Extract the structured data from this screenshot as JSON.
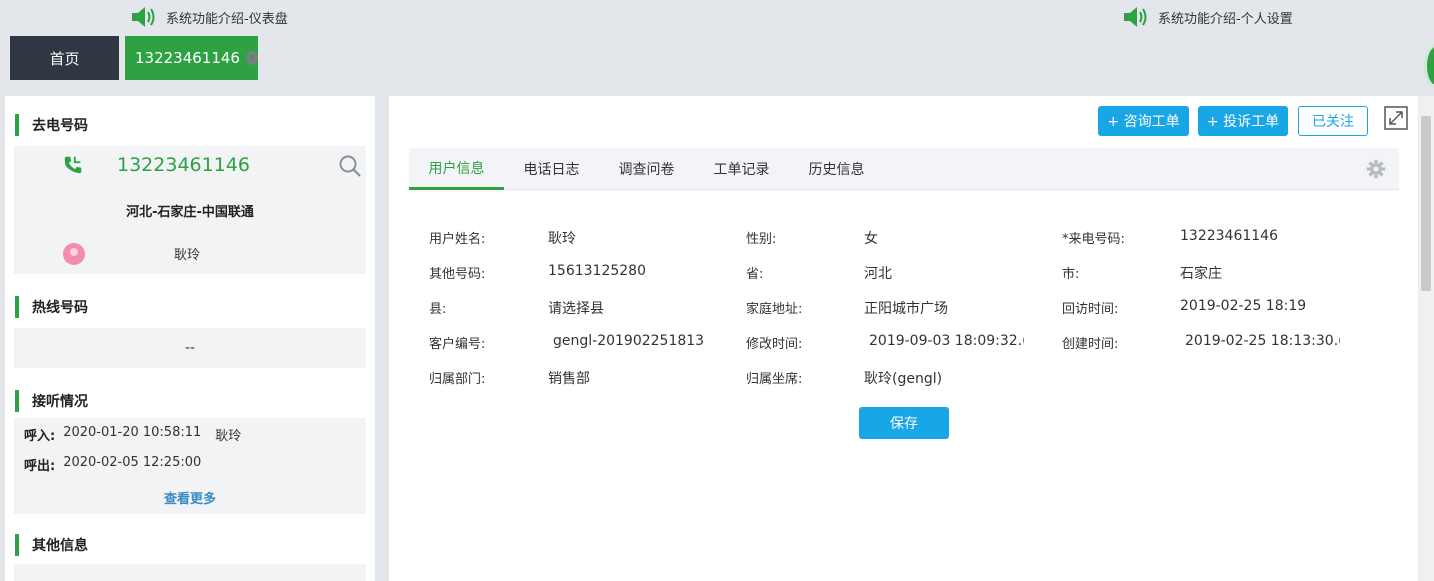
{
  "announcements": [
    "系统功能介绍-仪表盘",
    "系统功能介绍-个人设置"
  ],
  "tabs": {
    "home": "首页",
    "phone": "13223461146",
    "close_glyph": "×"
  },
  "left": {
    "outgoing": {
      "title": "去电号码",
      "number": "13223461146",
      "region": "河北-石家庄-中国联通",
      "user": "耿玲"
    },
    "hotline": {
      "title": "热线号码",
      "value": "--"
    },
    "calls": {
      "title": "接听情况",
      "in_label": "呼入:",
      "in_time": "2020-01-20 10:58:11",
      "in_user": "耿玲",
      "out_label": "呼出:",
      "out_time": "2020-02-05 12:25:00",
      "more": "查看更多"
    },
    "other": {
      "title": "其他信息"
    }
  },
  "actions": {
    "consult": "+ 咨询工单",
    "complain": "+ 投诉工单",
    "follow": "已关注"
  },
  "detail_tabs": [
    "用户信息",
    "电话日志",
    "调查问卷",
    "工单记录",
    "历史信息"
  ],
  "active_tab": "用户信息",
  "form": {
    "r1": {
      "l1": "用户姓名:",
      "v1": "耿玲",
      "l2": "性别:",
      "v2": "女",
      "l3": "*来电号码:",
      "v3": "13223461146"
    },
    "r2": {
      "l1": "其他号码:",
      "v1": "15613125280",
      "l2": "省:",
      "v2": "河北",
      "l3": "市:",
      "v3": "石家庄"
    },
    "r3": {
      "l1": "县:",
      "v1": "请选择县",
      "l2": "家庭地址:",
      "v2": "正阳城市广场",
      "l3": "回访时间:",
      "v3": "2019-02-25 18:19"
    },
    "r4": {
      "l1": "客户编号:",
      "v1": "gengl-201902251813",
      "l2": "修改时间:",
      "v2": "2019-09-03 18:09:32.(",
      "l3": "创建时间:",
      "v3": "2019-02-25 18:13:30.("
    },
    "r5": {
      "l1": "归属部门:",
      "v1": "销售部",
      "l2": "归属坐席:",
      "v2": "耿玲(gengl)"
    }
  },
  "save_label": "保存",
  "colors": {
    "green": "#2ea143",
    "blue": "#19a6e6",
    "dark": "#2f3743"
  }
}
